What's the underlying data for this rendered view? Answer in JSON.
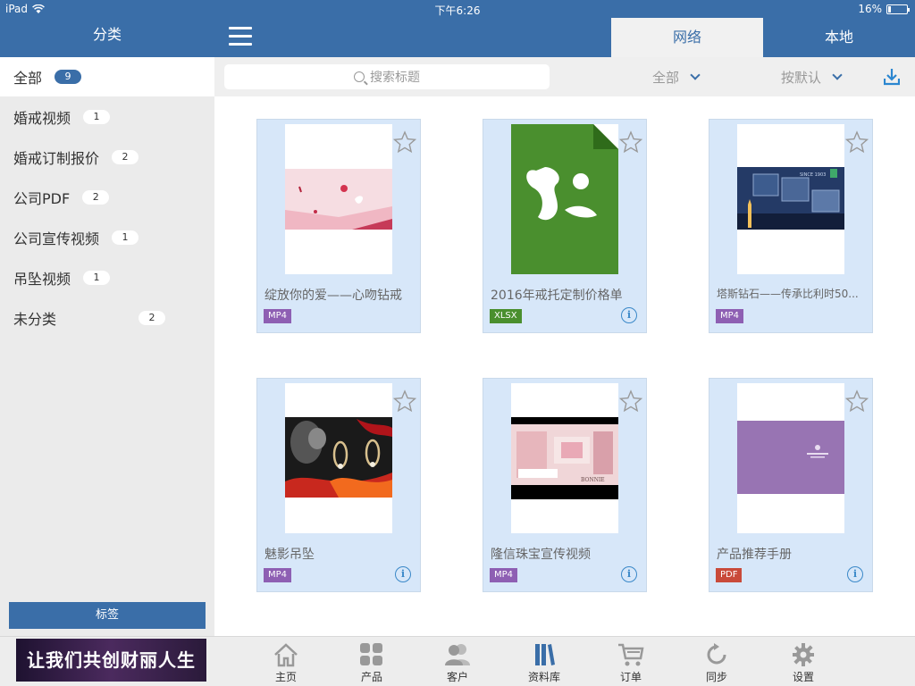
{
  "status_bar": {
    "device": "iPad",
    "time": "下午6:26",
    "battery": "16%",
    "battery_level": 0.16
  },
  "sidebar": {
    "title": "分类",
    "categories": [
      {
        "label": "全部",
        "count": "9",
        "active": true
      },
      {
        "label": "婚戒视频",
        "count": "1"
      },
      {
        "label": "婚戒订制报价",
        "count": "2"
      },
      {
        "label": "公司PDF",
        "count": "2"
      },
      {
        "label": "公司宣传视频",
        "count": "1"
      },
      {
        "label": "吊坠视频",
        "count": "1"
      },
      {
        "label": "未分类",
        "count": "2"
      }
    ],
    "tag_button": "标签"
  },
  "header": {
    "tabs": [
      {
        "label": "网络",
        "active": true
      },
      {
        "label": "本地",
        "active": false
      }
    ]
  },
  "filter": {
    "search_placeholder": "搜索标题",
    "filter_value": "全部",
    "sort_value": "按默认"
  },
  "cards": [
    {
      "title": "绽放你的爱——心吻钻戒",
      "type": "MP4",
      "type_color": "#8e5fb3",
      "starred": false,
      "info": false
    },
    {
      "title": "2016年戒托定制价格单",
      "type": "XLSX",
      "type_color": "#4a8f2e",
      "starred": false,
      "info": true
    },
    {
      "title": "塔斯钻石——传承比利时50...",
      "type": "MP4",
      "type_color": "#8e5fb3",
      "starred": false,
      "info": false
    },
    {
      "title": "魅影吊坠",
      "type": "MP4",
      "type_color": "#8e5fb3",
      "starred": false,
      "info": true
    },
    {
      "title": "隆信珠宝宣传视频",
      "type": "MP4",
      "type_color": "#8e5fb3",
      "starred": false,
      "info": true
    },
    {
      "title": "产品推荐手册",
      "type": "PDF",
      "type_color": "#c94a3a",
      "starred": false,
      "info": true
    }
  ],
  "bottom_bar": {
    "banner_text": "让我们共创财丽人生",
    "nav": [
      {
        "label": "主页",
        "icon": "home-icon"
      },
      {
        "label": "产品",
        "icon": "grid-icon"
      },
      {
        "label": "客户",
        "icon": "users-icon"
      },
      {
        "label": "资料库",
        "icon": "library-icon",
        "active": true
      },
      {
        "label": "订单",
        "icon": "cart-icon"
      },
      {
        "label": "同步",
        "icon": "sync-icon"
      },
      {
        "label": "设置",
        "icon": "gear-icon"
      }
    ]
  },
  "colors": {
    "brand": "#3a6ea8",
    "card_bg": "#d7e7f9",
    "mp4": "#8e5fb3",
    "xlsx": "#4a8f2e",
    "pdf": "#c94a3a",
    "info": "#3a88c8"
  }
}
